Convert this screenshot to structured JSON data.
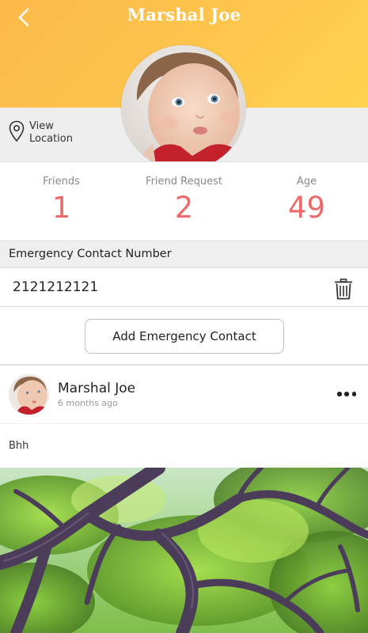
{
  "header": {
    "title": "Marshal Joe",
    "back_icon": "chevron-left-icon",
    "gradient": [
      "#fcb94a",
      "#ffd24f"
    ]
  },
  "location": {
    "icon": "map-pin-icon",
    "line1": "View",
    "line2": "Location"
  },
  "stats": [
    {
      "label": "Friends",
      "value": "1"
    },
    {
      "label": "Friend Request",
      "value": "2"
    },
    {
      "label": "Age",
      "value": "49"
    }
  ],
  "stats_color": "#ee6a6a",
  "emergency": {
    "title": "Emergency Contact Number",
    "number": "2121212121",
    "delete_icon": "trash-icon",
    "add_label": "Add Emergency Contact"
  },
  "post": {
    "author": "Marshal Joe",
    "time": "6 months ago",
    "text": "Bhh",
    "more_icon": "more-horizontal-icon"
  }
}
